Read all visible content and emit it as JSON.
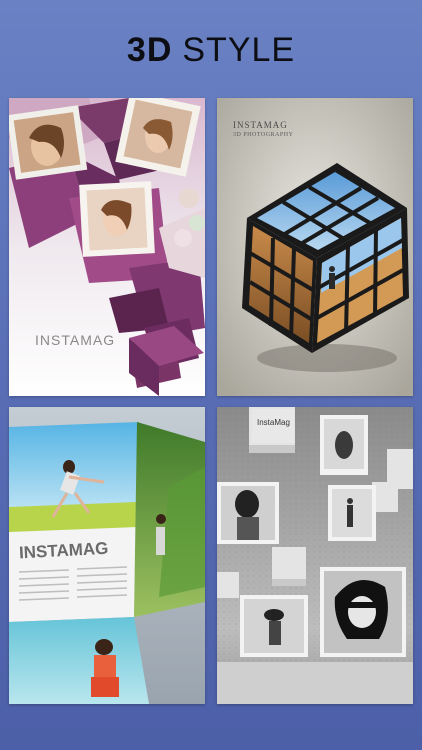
{
  "header": {
    "title_bold": "3D",
    "title_light": "STYLE"
  },
  "tiles": [
    {
      "brand": "INSTAMAG"
    },
    {
      "brand": "INSTAMAG",
      "subtitle": "3D PHOTOGRAPHY"
    },
    {
      "brand": "INSTAMAG"
    },
    {
      "brand": "InstaMag"
    }
  ]
}
